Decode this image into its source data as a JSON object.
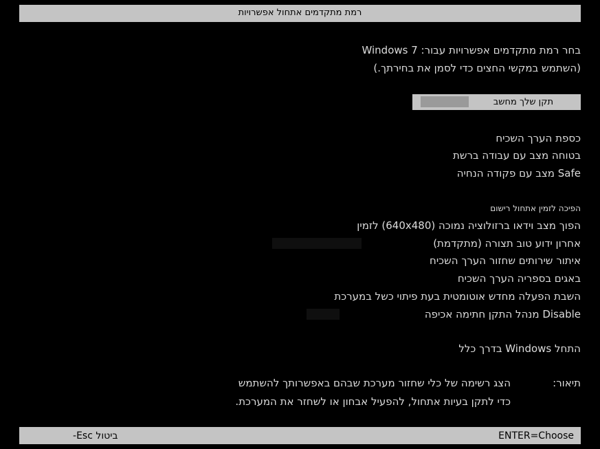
{
  "title": "רמת מתקדמים אתחול אפשרויות",
  "intro": {
    "line1": "בחר רמת מתקדמים אפשרויות עבור: Windows 7",
    "line2": "(השתמש במקשי החצים כדי לסמן את בחירתך.)"
  },
  "selected_option": "תקן שלך מחשב",
  "options": [
    "כספת הערך השכיח",
    "בטוחה מצב עם עבודה ברשת",
    "Safe מצב עם פקודה הנחיה",
    "הפיכה לזמין אתחול רישום",
    "הפוך מצב וידאו ברזולוציה נמוכה (640x480) לזמין",
    "אחרון ידוע טוב תצורה (מתקדמת)",
    "איתור שירותים שחזור הערך השכיח",
    "באגים בספריה הערך השכיח",
    "השבת הפעלה מחדש אוטומטית בעת פיתוי כשל במערכת",
    "Disable מנהל התקן חתימה אכיפה"
  ],
  "normal_start": "התחל Windows בדרך כלל",
  "description": {
    "label": "תיאור:",
    "line1": "הצג רשימה של כלי שחזור מערכת שבהם באפשרותך להשתמש",
    "line2": "כדי לתקן בעיות אתחול, להפעיל אבחון או לשחזר את המערכת."
  },
  "footer": {
    "enter": "ENTER=Choose",
    "esc": "ביטול Esc-"
  }
}
